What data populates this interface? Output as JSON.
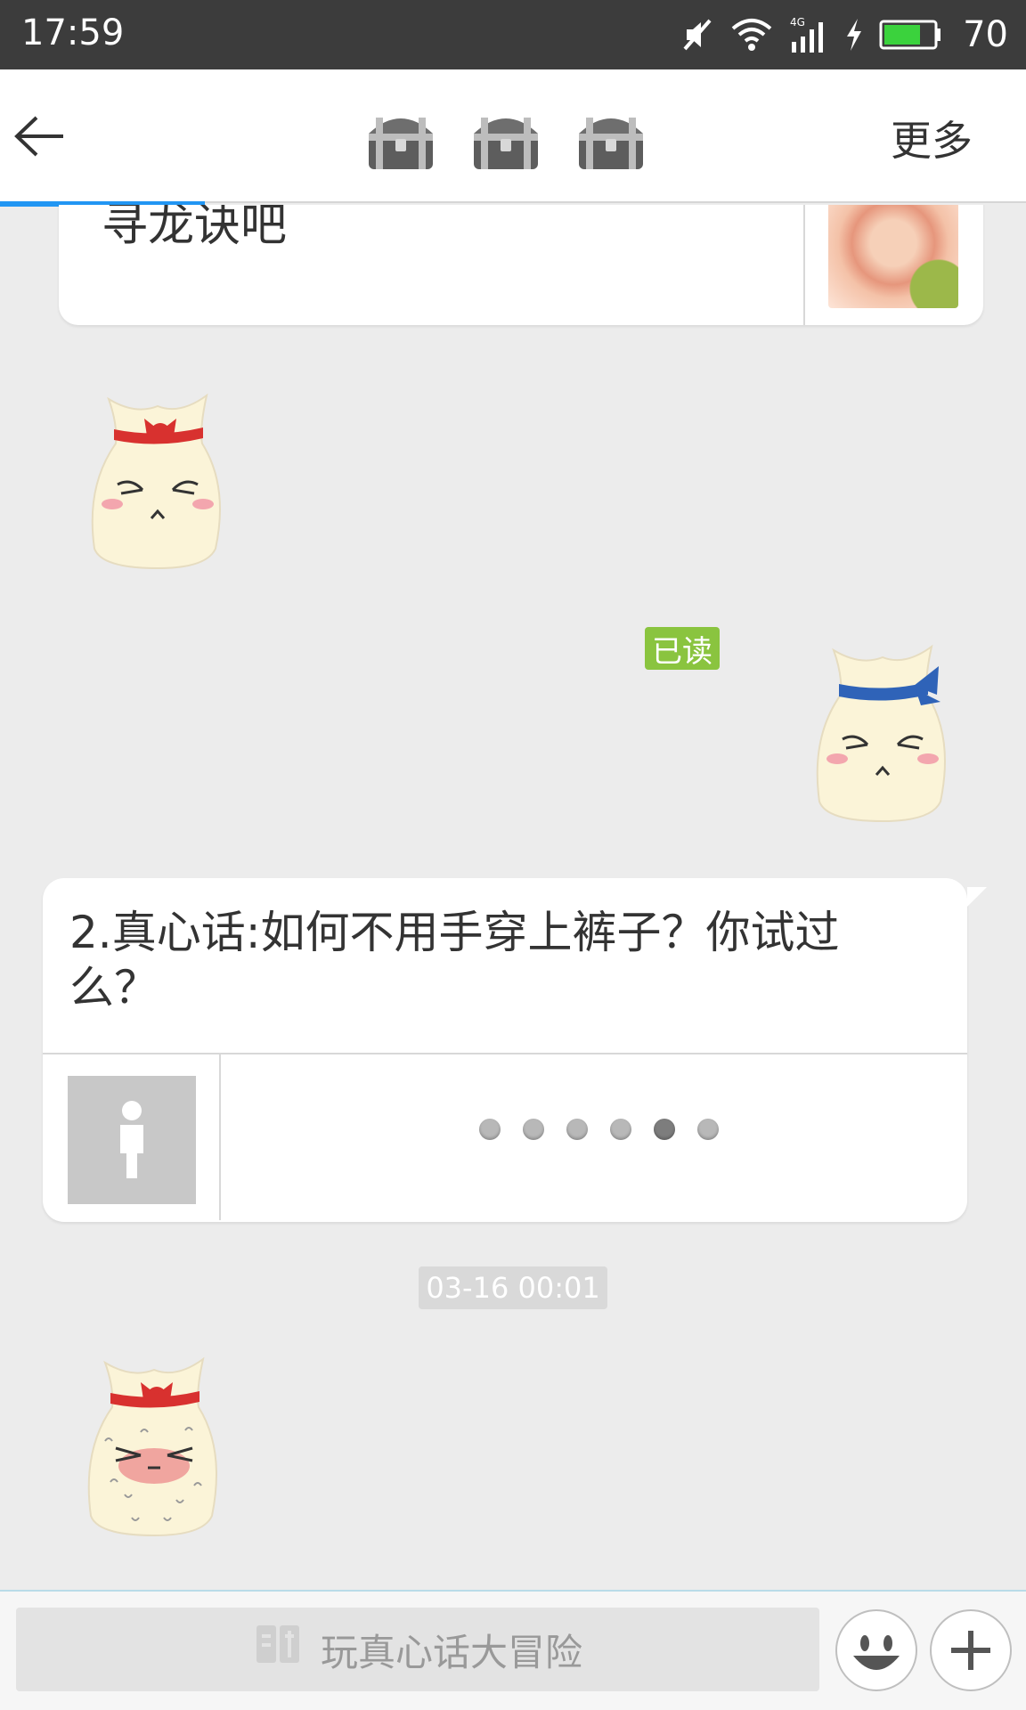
{
  "status_bar": {
    "time": "17:59",
    "battery_level": "70",
    "icons": [
      "mute-icon",
      "wifi-icon",
      "signal-4g-icon",
      "charging-icon",
      "battery-icon"
    ]
  },
  "header": {
    "back_icon": "back-arrow-icon",
    "chest_icons": [
      "treasure-chest-icon",
      "treasure-chest-icon",
      "treasure-chest-icon"
    ],
    "more_label": "更多"
  },
  "messages": [
    {
      "type": "text-with-image",
      "text": "寻龙诀吧",
      "image": "flower-photo"
    },
    {
      "type": "sticker",
      "side": "left",
      "sticker": "sack-red-bow-squint"
    },
    {
      "type": "sticker",
      "side": "right",
      "sticker": "sack-blue-bow-squint",
      "read_status": "已读"
    },
    {
      "type": "game-question",
      "text": "2.真心话:如何不用手穿上裤子？你试过么？",
      "loading_dots": 6
    },
    {
      "type": "timestamp",
      "text": "03-16 00:01"
    },
    {
      "type": "sticker",
      "side": "left",
      "sticker": "sack-red-bow-blushing"
    }
  ],
  "input_bar": {
    "placeholder": "玩真心话大冒险",
    "game_icon": "game-icon",
    "emoji_icon": "smiley-icon",
    "plus_icon": "plus-icon"
  },
  "colors": {
    "status_bar": "#3c3c3c",
    "progress": "#2196f3",
    "read_badge": "#8ac43f",
    "chat_bg": "#ececec"
  }
}
